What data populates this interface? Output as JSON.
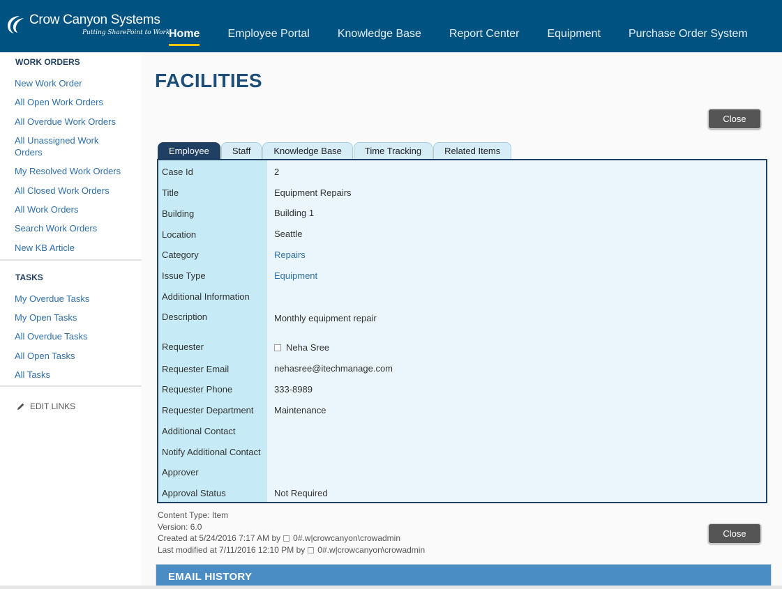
{
  "brand": {
    "name": "Crow Canyon Systems",
    "tagline": "Putting SharePoint to Work"
  },
  "top_nav": [
    {
      "label": "Home",
      "active": true
    },
    {
      "label": "Employee Portal"
    },
    {
      "label": "Knowledge Base"
    },
    {
      "label": "Report Center"
    },
    {
      "label": "Equipment"
    },
    {
      "label": "Purchase Order System"
    }
  ],
  "sidebar": {
    "work_orders_heading": "WORK ORDERS",
    "work_orders": [
      "New Work Order",
      "All Open Work Orders",
      "All Overdue Work Orders",
      "All Unassigned Work Orders",
      "My Resolved Work Orders",
      "All Closed Work Orders",
      "All Work Orders",
      "Search Work Orders",
      "New KB Article"
    ],
    "tasks_heading": "TASKS",
    "tasks": [
      "My Overdue Tasks",
      "My Open Tasks",
      "All Overdue Tasks",
      "All Open Tasks",
      "All Tasks"
    ],
    "edit_links": "EDIT LINKS"
  },
  "page": {
    "title": "FACILITIES",
    "close_label": "Close"
  },
  "tabs": [
    {
      "label": "Employee",
      "active": true
    },
    {
      "label": "Staff"
    },
    {
      "label": "Knowledge Base"
    },
    {
      "label": "Time Tracking"
    },
    {
      "label": "Related Items"
    }
  ],
  "fields": [
    {
      "label": "Case Id",
      "value": "2"
    },
    {
      "label": "Title",
      "value": "Equipment Repairs"
    },
    {
      "label": "Building",
      "value": "Building 1"
    },
    {
      "label": "Location",
      "value": "Seattle"
    },
    {
      "label": "Category",
      "value": "Repairs",
      "link": true
    },
    {
      "label": "Issue Type",
      "value": "Equipment",
      "link": true
    },
    {
      "label": "Additional Information",
      "value": ""
    },
    {
      "label": "Description",
      "value": "Monthly equipment repair"
    },
    {
      "label": "Requester",
      "value": "Neha Sree",
      "checkbox": true
    },
    {
      "label": "Requester Email",
      "value": "nehasree@itechmanage.com"
    },
    {
      "label": "Requester Phone",
      "value": "333-8989"
    },
    {
      "label": "Requester Department",
      "value": "Maintenance"
    },
    {
      "label": "Additional Contact",
      "value": ""
    },
    {
      "label": "Notify Additional Contact",
      "value": ""
    },
    {
      "label": "Approver",
      "value": ""
    },
    {
      "label": "Approval Status",
      "value": "Not Required"
    }
  ],
  "meta": {
    "content_type": "Content Type: Item",
    "version": "Version: 6.0",
    "created": "Created at 5/24/2016 7:17 AM",
    "created_by_label": "by",
    "created_by": "0#.w|crowcanyon\\crowadmin",
    "modified": "Last modified at 7/11/2016 12:10 PM",
    "modified_by_label": "by",
    "modified_by": "0#.w|crowcanyon\\crowadmin"
  },
  "email_history": {
    "heading": "EMAIL HISTORY"
  },
  "colors": {
    "topbar": "#005380",
    "active_tab": "#1f3f63",
    "link": "#2f6fa8",
    "title": "#1c4e78",
    "email_header": "#4a8cc4",
    "nav_underline": "#f5c400"
  }
}
